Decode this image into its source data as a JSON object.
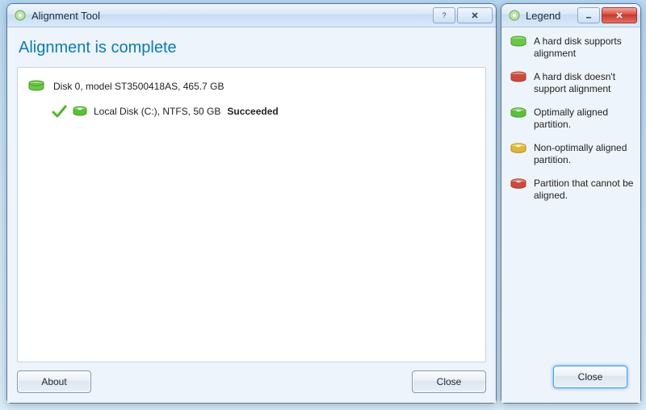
{
  "main": {
    "title": "Alignment Tool",
    "heading": "Alignment is complete",
    "disk_line": "Disk 0, model ST3500418AS, 465.7 GB",
    "partition_line": "Local Disk (C:), NTFS, 50 GB",
    "partition_status": "Succeeded",
    "about_button": "About",
    "close_button": "Close"
  },
  "legend": {
    "title": "Legend",
    "items": [
      "A hard disk supports alignment",
      "A hard disk doesn't support alignment",
      "Optimally aligned partition.",
      "Non-optimally aligned partition.",
      "Partition that cannot be aligned."
    ],
    "close_button": "Close"
  },
  "icons": {
    "colors": {
      "green": "#5bbf3a",
      "red": "#cc4a3a",
      "yellow": "#e1b63a"
    }
  }
}
